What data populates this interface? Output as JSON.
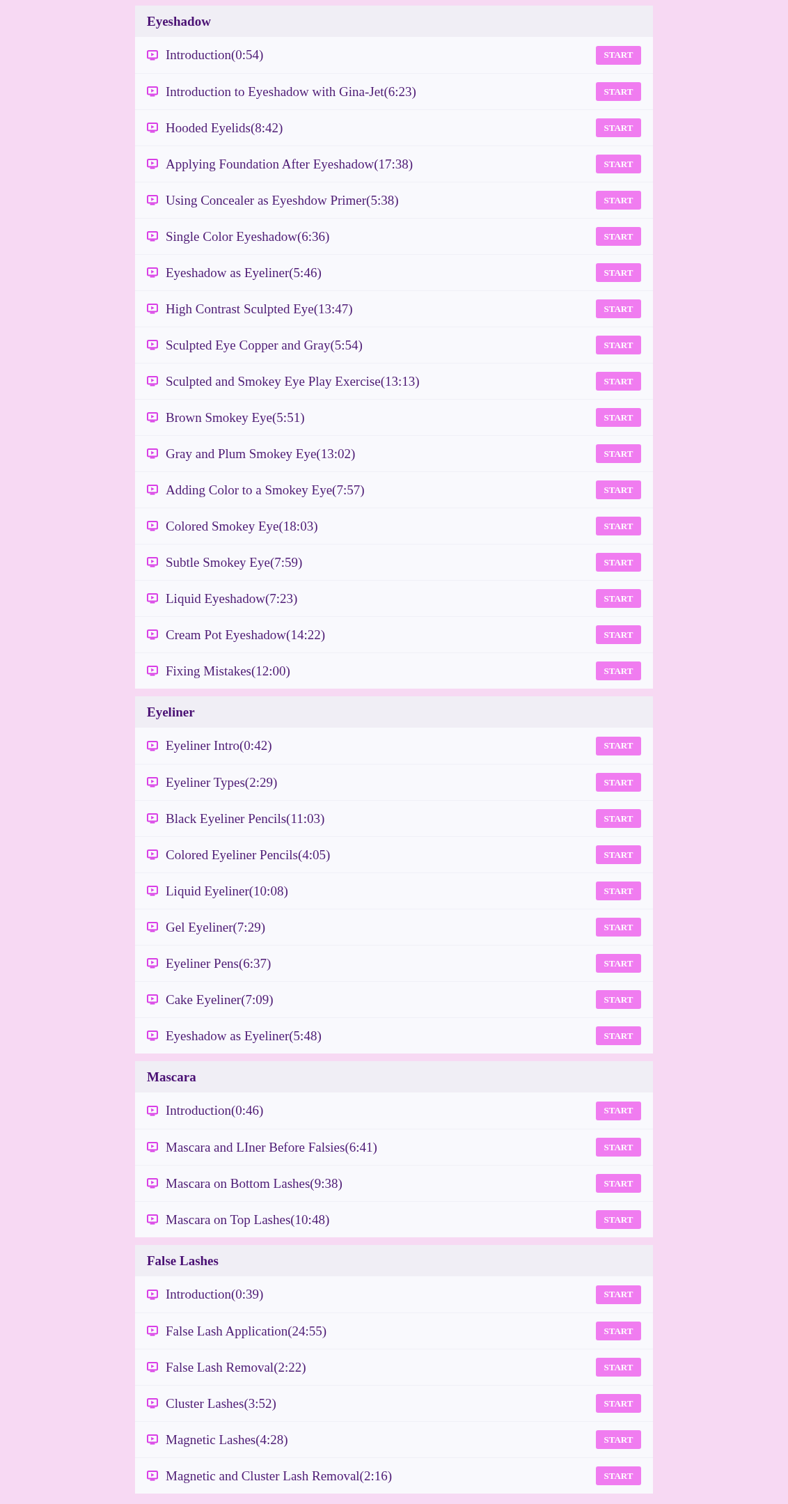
{
  "sections": [
    {
      "title": "Eyeshadow",
      "lessons": [
        {
          "title": "Introduction(0:54)",
          "button": "START"
        },
        {
          "title": "Introduction to Eyeshadow with Gina-Jet(6:23)",
          "button": "START"
        },
        {
          "title": "Hooded Eyelids(8:42)",
          "button": "START"
        },
        {
          "title": "Applying Foundation After Eyeshadow(17:38)",
          "button": "START"
        },
        {
          "title": "Using Concealer as Eyeshdow Primer(5:38)",
          "button": "START"
        },
        {
          "title": "Single Color Eyeshadow(6:36)",
          "button": "START"
        },
        {
          "title": "Eyeshadow as Eyeliner(5:46)",
          "button": "START"
        },
        {
          "title": "High Contrast Sculpted Eye(13:47)",
          "button": "START"
        },
        {
          "title": "Sculpted Eye Copper and Gray(5:54)",
          "button": "START"
        },
        {
          "title": "Sculpted and Smokey Eye Play Exercise(13:13)",
          "button": "START"
        },
        {
          "title": "Brown Smokey Eye(5:51)",
          "button": "START"
        },
        {
          "title": "Gray and Plum Smokey Eye(13:02)",
          "button": "START"
        },
        {
          "title": "Adding Color to a Smokey Eye(7:57)",
          "button": "START"
        },
        {
          "title": "Colored Smokey Eye(18:03)",
          "button": "START"
        },
        {
          "title": "Subtle Smokey Eye(7:59)",
          "button": "START"
        },
        {
          "title": "Liquid Eyeshadow(7:23)",
          "button": "START"
        },
        {
          "title": "Cream Pot Eyeshadow(14:22)",
          "button": "START"
        },
        {
          "title": "Fixing Mistakes(12:00)",
          "button": "START"
        }
      ]
    },
    {
      "title": "Eyeliner",
      "lessons": [
        {
          "title": "Eyeliner Intro(0:42)",
          "button": "START"
        },
        {
          "title": "Eyeliner Types(2:29)",
          "button": "START"
        },
        {
          "title": "Black Eyeliner Pencils(11:03)",
          "button": "START"
        },
        {
          "title": "Colored Eyeliner Pencils(4:05)",
          "button": "START"
        },
        {
          "title": "Liquid Eyeliner(10:08)",
          "button": "START"
        },
        {
          "title": "Gel Eyeliner(7:29)",
          "button": "START"
        },
        {
          "title": "Eyeliner Pens(6:37)",
          "button": "START"
        },
        {
          "title": "Cake Eyeliner(7:09)",
          "button": "START"
        },
        {
          "title": "Eyeshadow as Eyeliner(5:48)",
          "button": "START"
        }
      ]
    },
    {
      "title": "Mascara",
      "lessons": [
        {
          "title": "Introduction(0:46)",
          "button": "START"
        },
        {
          "title": "Mascara and LIner Before Falsies(6:41)",
          "button": "START"
        },
        {
          "title": "Mascara on Bottom Lashes(9:38)",
          "button": "START"
        },
        {
          "title": "Mascara on Top Lashes(10:48)",
          "button": "START"
        }
      ]
    },
    {
      "title": "False Lashes",
      "lessons": [
        {
          "title": "Introduction(0:39)",
          "button": "START"
        },
        {
          "title": "False Lash Application(24:55)",
          "button": "START"
        },
        {
          "title": "False Lash Removal(2:22)",
          "button": "START"
        },
        {
          "title": "Cluster Lashes(3:52)",
          "button": "START"
        },
        {
          "title": "Magnetic Lashes(4:28)",
          "button": "START"
        },
        {
          "title": "Magnetic and Cluster Lash Removal(2:16)",
          "button": "START"
        }
      ]
    }
  ]
}
